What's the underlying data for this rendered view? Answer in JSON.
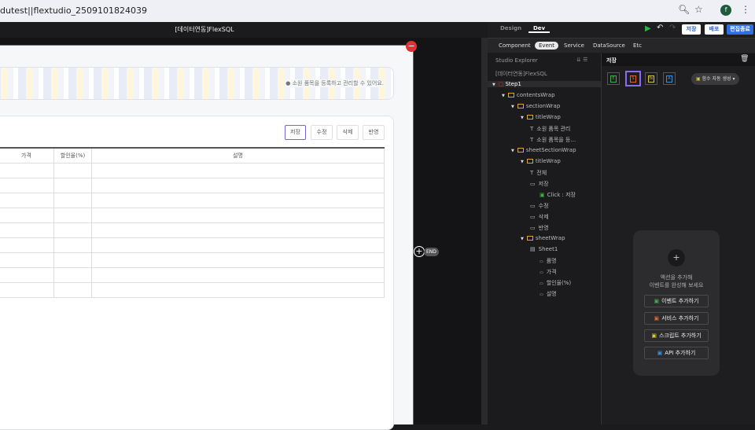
{
  "browser": {
    "url": "dutest||flextudio_2509101824039",
    "avatar": "f"
  },
  "app": {
    "title": "[데이터연동]FlexSQL",
    "end_label": "END"
  },
  "page": {
    "banner_text": "소원 품목을 등록하고 관리할 수 있어요.",
    "buttons": [
      "저장",
      "수정",
      "삭제",
      "반영"
    ],
    "columns": [
      "가격",
      "할인율(%)",
      "설명"
    ],
    "row_count": 9
  },
  "panel": {
    "tabs": [
      "Design",
      "Dev"
    ],
    "actions": {
      "save": "저장",
      "memo": "배포",
      "finish": "편집종료"
    },
    "subtabs": [
      "Component",
      "Event",
      "Service",
      "DataSource",
      "Etc"
    ],
    "explorer": {
      "title": "Studio Explorer",
      "root": "[데이터연동]FlexSQL",
      "nodes": [
        "Step1",
        "contentsWrap",
        "sectionWrap",
        "titleWrap",
        "소원 품목 관리",
        "소원 품목을 등...",
        "sheetSectionWrap",
        "titleWrap",
        "전체",
        "저장",
        "Click : 저장",
        "수정",
        "삭제",
        "반영",
        "sheetWrap",
        "Sheet1",
        "품명",
        "가격",
        "할인율(%)",
        "설명"
      ]
    },
    "event": {
      "title": "저장",
      "auto_fn": "함수 자동 생성",
      "hint": [
        "액션을 추가해",
        "이벤트를 완성해 보세요"
      ],
      "add_buttons": [
        "이벤트 추가하기",
        "서비스 추가하기",
        "스크립트 추가하기",
        "API 추가하기"
      ]
    },
    "colors": {
      "event": "#3fae4a",
      "service": "#e0662a",
      "script": "#d6c640",
      "api": "#3a8fd6",
      "accent": "#8a6cf0"
    }
  }
}
